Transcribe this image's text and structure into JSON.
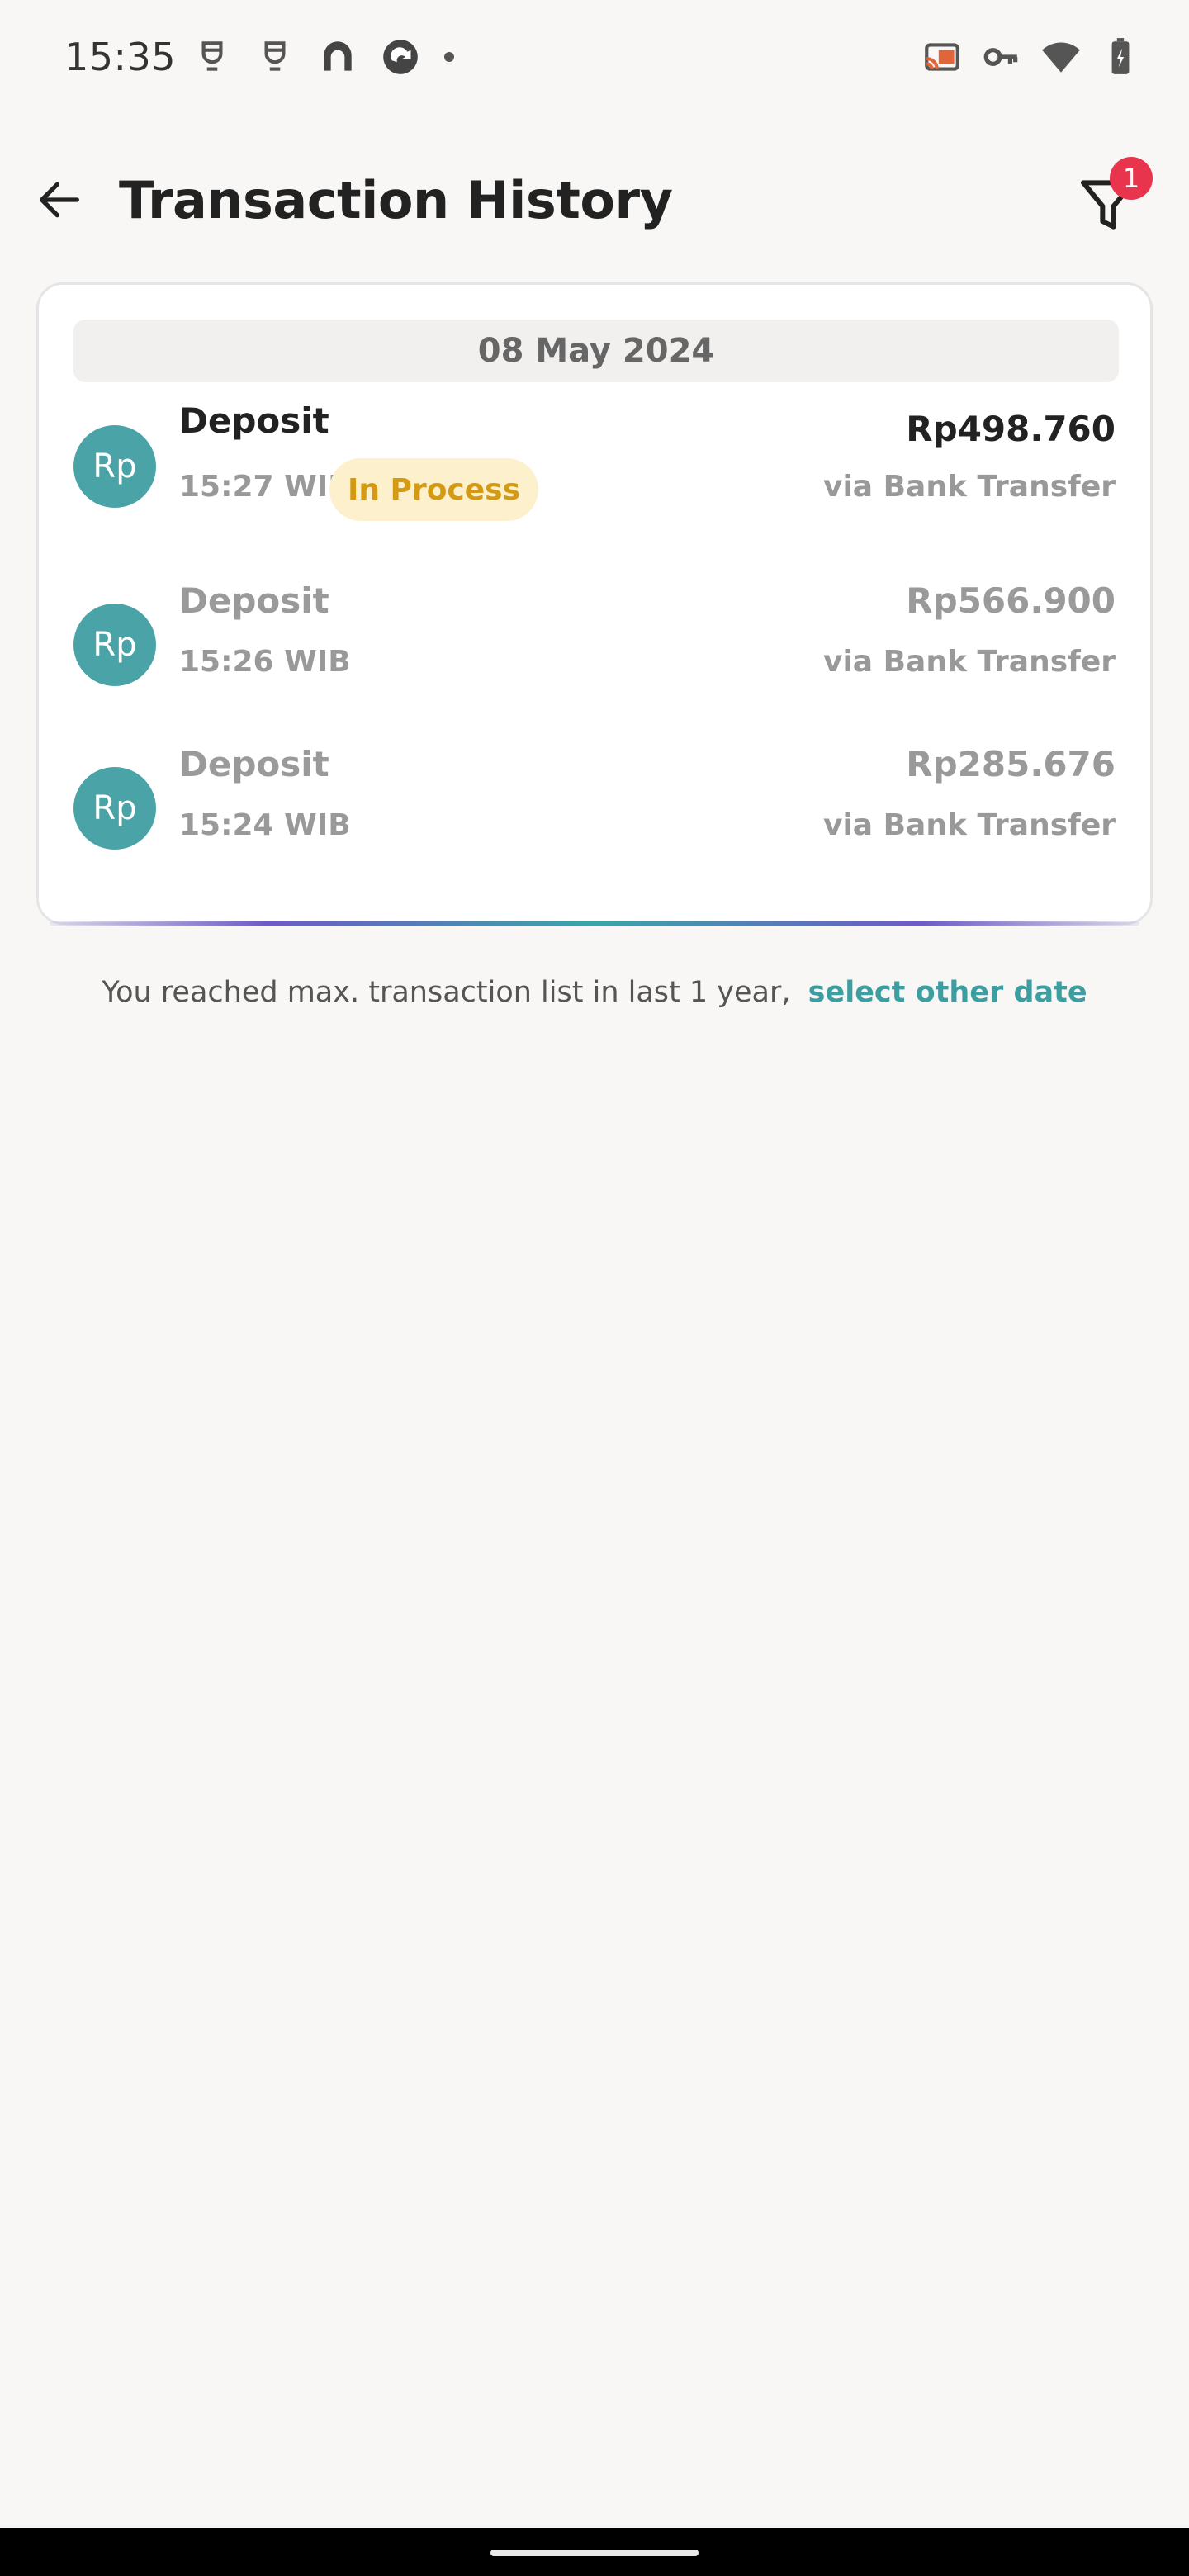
{
  "status_bar": {
    "time": "15:35",
    "left_icons": [
      "notification-icon",
      "notification-icon",
      "app-icon",
      "app-icon",
      "dot-icon"
    ],
    "right_icons": [
      "cast-icon",
      "vpn-key-icon",
      "wifi-icon",
      "battery-charging-icon"
    ]
  },
  "header": {
    "title": "Transaction History",
    "filter_badge_count": "1"
  },
  "transactions": {
    "date": "08 May 2024",
    "items": [
      {
        "avatar": "Rp",
        "title": "Deposit",
        "time": "15:27 WIB",
        "status": "In Process",
        "amount": "Rp498.760",
        "method": "via Bank Transfer"
      },
      {
        "avatar": "Rp",
        "title": "Deposit",
        "time": "15:26 WIB",
        "amount": "Rp566.900",
        "method": "via Bank Transfer"
      },
      {
        "avatar": "Rp",
        "title": "Deposit",
        "time": "15:24 WIB",
        "amount": "Rp285.676",
        "method": "via Bank Transfer"
      }
    ]
  },
  "footer": {
    "note": "You reached max. transaction list in last 1 year,",
    "link": "select other date"
  },
  "colors": {
    "accent": "#4aa3a6",
    "badge": "#e8354d",
    "pending_bg": "#fdf0cc",
    "pending_text": "#d49a14"
  }
}
